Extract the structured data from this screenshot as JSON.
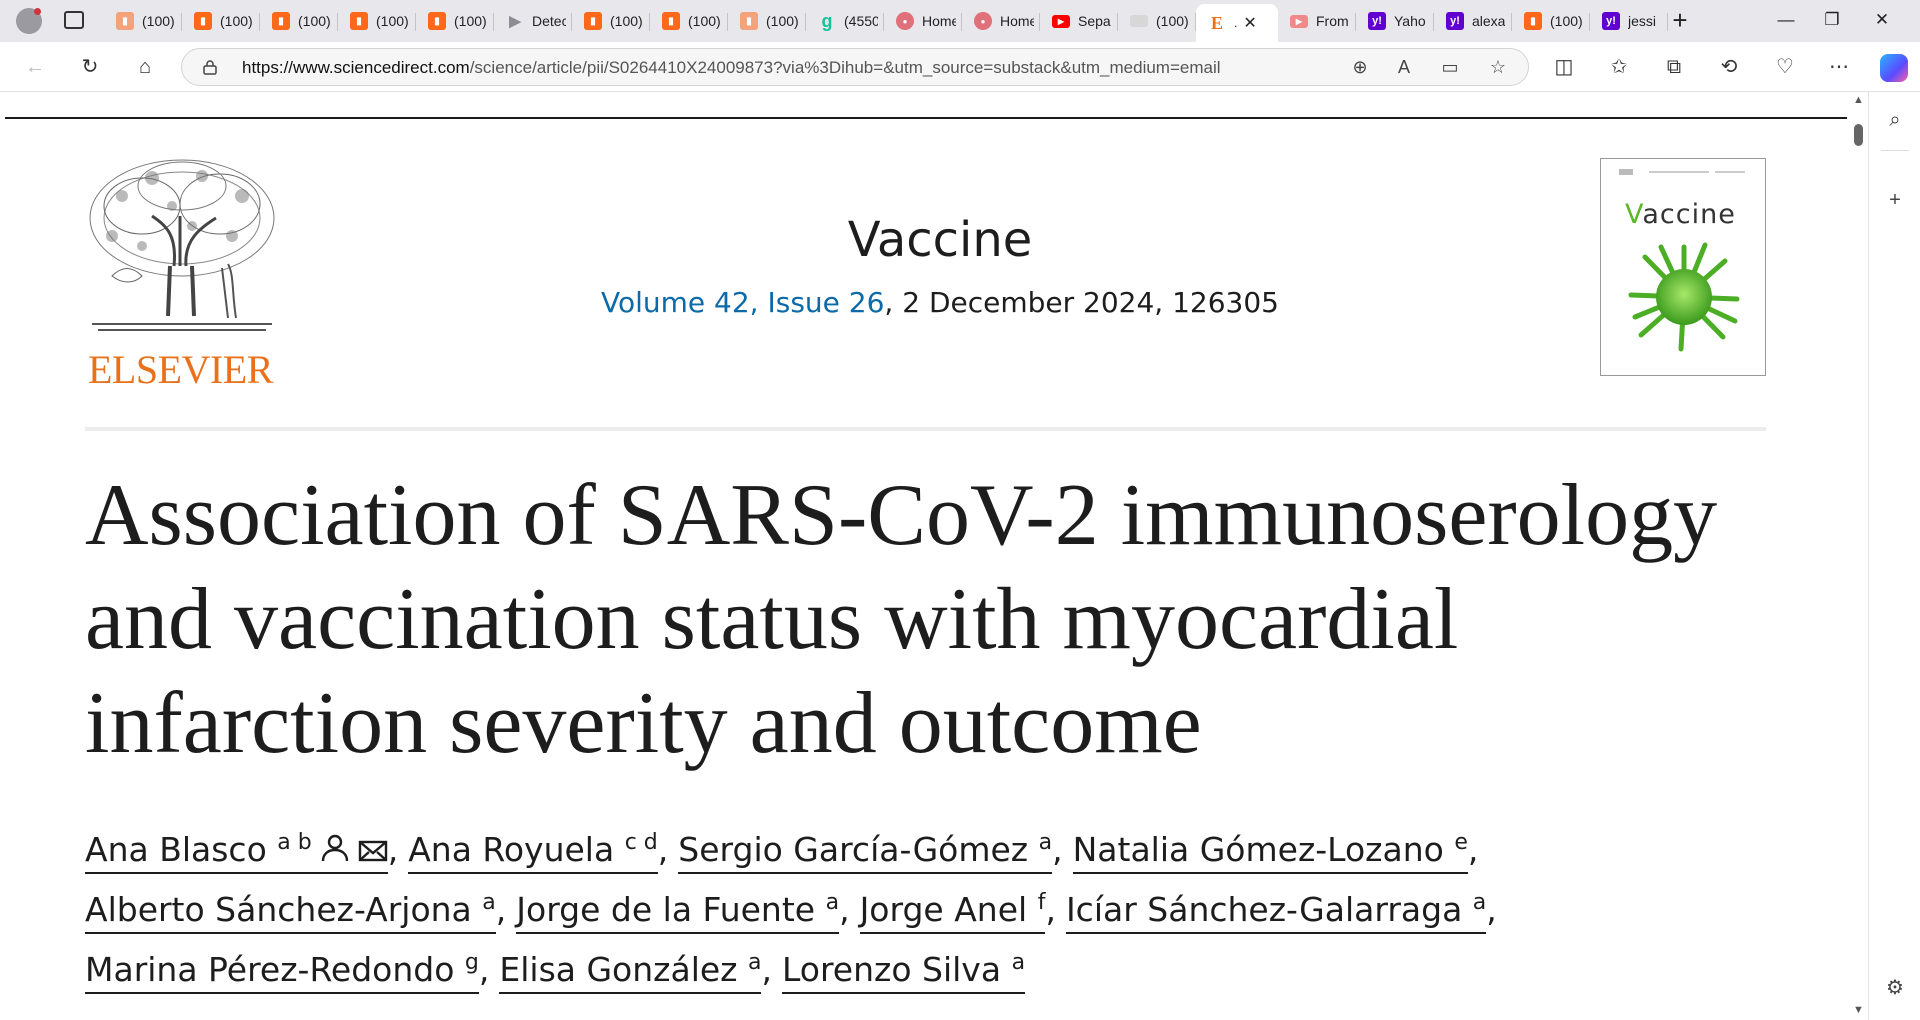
{
  "browser": {
    "tabs": [
      {
        "title": "(100)",
        "icon": "substack-icon",
        "color": "#f4a27a"
      },
      {
        "title": "(100)",
        "icon": "substack-icon",
        "color": "#ff6719"
      },
      {
        "title": "(100)",
        "icon": "substack-icon",
        "color": "#ff6719"
      },
      {
        "title": "(100)",
        "icon": "substack-icon",
        "color": "#ff6719"
      },
      {
        "title": "(100)",
        "icon": "substack-icon",
        "color": "#ff6719"
      },
      {
        "title": "Detec",
        "icon": "arrow-icon",
        "color": "#8c8c94"
      },
      {
        "title": "(100)",
        "icon": "substack-icon",
        "color": "#ff6719"
      },
      {
        "title": "(100)",
        "icon": "substack-icon",
        "color": "#ff6719"
      },
      {
        "title": "(100)",
        "icon": "substack-icon",
        "color": "#f4a27a"
      },
      {
        "title": "(4550",
        "icon": "grammarly-icon",
        "color": "#15c39a"
      },
      {
        "title": "Home",
        "icon": "home-site-icon",
        "color": "#e0707a"
      },
      {
        "title": "Home",
        "icon": "home-site-icon",
        "color": "#e0707a"
      },
      {
        "title": "Sepa",
        "icon": "youtube-icon",
        "color": "#ff0000"
      },
      {
        "title": "(100)",
        "icon": "blank-page-icon",
        "color": "#d7d7d7"
      },
      {
        "title": "",
        "icon": "elsevier-e-icon",
        "color": "#ffffff",
        "active": true
      },
      {
        "title": "From",
        "icon": "youtube-icon",
        "color": "#f08a8a"
      },
      {
        "title": "Yaho",
        "icon": "yahoo-icon",
        "color": "#6001d2"
      },
      {
        "title": "alexa",
        "icon": "yahoo-icon",
        "color": "#6001d2"
      },
      {
        "title": "(100)",
        "icon": "substack-icon",
        "color": "#ff6719"
      },
      {
        "title": "jessi",
        "icon": "yahoo-icon",
        "color": "#6001d2"
      }
    ],
    "address": {
      "domain": "https://www.sciencedirect.com",
      "path": "/science/article/pii/S0264410X24009873?via%3Dihub=&utm_source=substack&utm_medium=email"
    }
  },
  "article": {
    "publisher": "ELSEVIER",
    "journal": "Vaccine",
    "issue_link": "Volume 42, Issue 26",
    "issue_rest": ", 2 December 2024, 126305",
    "cover_title": "accine",
    "cover_title_v": "V",
    "title": "Association of SARS-CoV-2 immunoserology and vaccination status with myocardial infarction severity and outcome",
    "authors": [
      {
        "name": "Ana Blasco",
        "sup": "a b",
        "corresponding": true
      },
      {
        "name": "Ana Royuela",
        "sup": "c d"
      },
      {
        "name": "Sergio García-Gómez",
        "sup": "a"
      },
      {
        "name": "Natalia Gómez-Lozano",
        "sup": "e"
      },
      {
        "name": "Alberto Sánchez-Arjona",
        "sup": "a"
      },
      {
        "name": "Jorge de la Fuente",
        "sup": "a"
      },
      {
        "name": "Jorge Anel",
        "sup": "f"
      },
      {
        "name": "Icíar Sánchez-Galarraga",
        "sup": "a"
      },
      {
        "name": "Marina Pérez-Redondo",
        "sup": "g"
      },
      {
        "name": "Elisa González",
        "sup": "a"
      },
      {
        "name": "Lorenzo Silva",
        "sup": "a"
      }
    ]
  },
  "colors": {
    "link": "#0c6aa8",
    "elsevier_orange": "#e9711c",
    "text": "#1d1d1d"
  }
}
